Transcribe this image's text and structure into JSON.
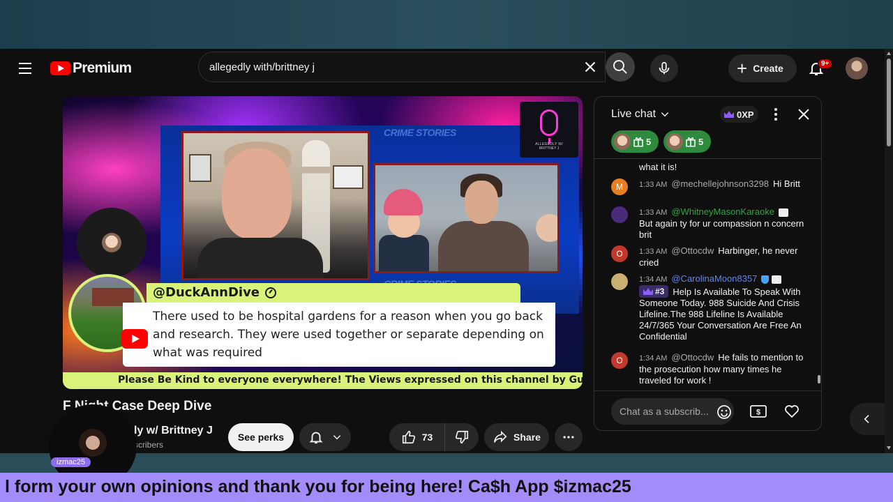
{
  "brand": {
    "logo_text": "Premium"
  },
  "search": {
    "value": "allegedly with/brittney j",
    "placeholder": "Search"
  },
  "header": {
    "create_label": "Create",
    "notification_count": "9+"
  },
  "video": {
    "title": "F        Night Case Deep Dive",
    "overlay": {
      "comment_author": "@DuckAnnDive",
      "comment_text": "There used to be hospital gardens for a reason when you go back and research. They were used together or separate depending on what was required",
      "ticker": "Please Be Kind to everyone everywhere! The Views expressed on this channel by Guest a",
      "crime_word": "CRIME STORIES",
      "logo_caption_1": "ALLEGEDLY W/",
      "logo_caption_2": "BRITTNEY J"
    }
  },
  "channel": {
    "name": "ly w/ Brittney J",
    "subs": "scribers"
  },
  "actions": {
    "perks_label": "See perks",
    "like_count": "73",
    "share_label": "Share"
  },
  "chat": {
    "title": "Live chat",
    "xp": "0XP",
    "gifts": [
      {
        "count": "5"
      },
      {
        "count": "5"
      }
    ],
    "input_placeholder": "Chat as a subscrib...",
    "messages": [
      {
        "initial": "",
        "time": "",
        "author": "",
        "text": "what it is!",
        "avatar_color": "#0f0f0f"
      },
      {
        "initial": "M",
        "time": "1:33 AM",
        "author": "@mechellejohnson3298",
        "text": "Hi Britt",
        "avatar_color": "#e67e22"
      },
      {
        "initial": "",
        "time": "1:33 AM",
        "author": "@WhitneyMasonKaraoke",
        "text": "But again ty for ur compassion n concern brit",
        "avatar_color": "#4a2a7a"
      },
      {
        "initial": "O",
        "time": "1:33 AM",
        "author": "@Ottocdw",
        "text": "Harbinger, he never cried",
        "avatar_color": "#c0392b"
      },
      {
        "initial": "",
        "time": "1:34 AM",
        "author": "@CarolinaMoon8357",
        "badge": "#3",
        "text": "Help Is Available To Speak With Someone Today. 988 Suicide And Crisis Lifeline.The 988 Lifeline Is Available 24/7/365 Your Conversation Are Free An Confidential",
        "avatar_color": "#c9b070"
      },
      {
        "initial": "O",
        "time": "1:34 AM",
        "author": "@Ottocdw",
        "text": "He fails to mention to the prosecution how many times he traveled for work !",
        "avatar_color": "#c0392b"
      }
    ]
  },
  "overlay_stream": {
    "streamer_tag": "izmac25",
    "marquee": "l form your own opinions and thank you for being here! Ca$h App $izmac25"
  }
}
